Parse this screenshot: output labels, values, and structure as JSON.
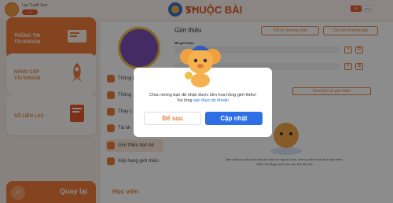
{
  "header": {
    "username": "Lạc Tuyết Sơn",
    "user_badge": "LV.1",
    "logo_text": "THUỘC BÀI",
    "lang_vie": "VIE",
    "lang_eng": "ENG"
  },
  "sidebar": {
    "cards": [
      {
        "label_line1": "THÔNG TIN",
        "label_line2": "TÀI KHOẢN"
      },
      {
        "label_line1": "NÂNG CẤP",
        "label_line2": "TÀI KHOẢN"
      },
      {
        "label_line1": "SỔ LIÊN LẠC",
        "label_line2": ""
      }
    ],
    "back_label": "Quay lại"
  },
  "menu": {
    "items": [
      "Thông tin",
      "Thông",
      "Thay c",
      "Tài kh",
      "Giới thiệu bạn bè",
      "Xếp hạng giới thiệu"
    ]
  },
  "main": {
    "section_title": "Giới thiệu",
    "btn_rules": "Thể lệ chương trình",
    "btn_faq": "Câu hỏi thường gặp",
    "field_label": "Mã giới thiệu",
    "history_button": "Xem lịch sử giới thiệu",
    "partial_title": "u",
    "info_text": "Bạn đã thực hiện thao tác giới thiệu từ người khác, nhưng vẫn chưa được ghi nhận.",
    "info_text_2": "Kiểm tra bằng cách như vào link liên kết",
    "footer_label": "Học viên"
  },
  "dialog": {
    "message_line1": "Chúc mừng bạn đã nhận được tiền hoa hồng giới thiệu!",
    "message_line2": "Vui lòng",
    "link_text": "xác thực tài khoản",
    "btn_later": "Để sau",
    "btn_update": "Cập nhật"
  },
  "colors": {
    "accent": "#ef7c3a",
    "primary_blue": "#2e6fe6",
    "overlay": "rgba(0,0,0,0.45)"
  }
}
